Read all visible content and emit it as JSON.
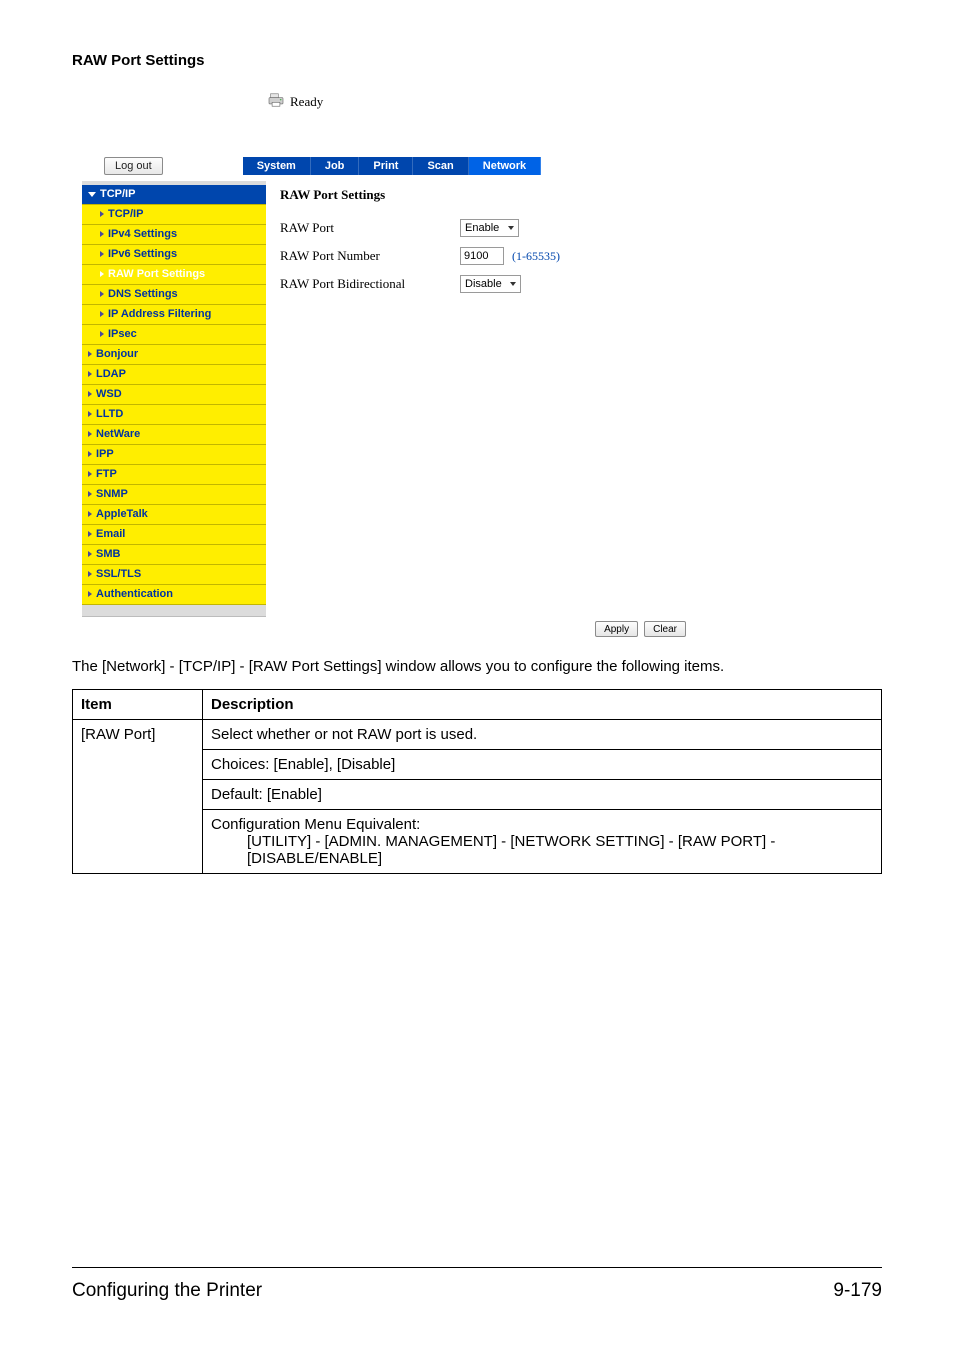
{
  "section_heading": "RAW Port Settings",
  "status_text": "Ready",
  "logout_label": "Log out",
  "tabs": {
    "system": "System",
    "job": "Job",
    "print": "Print",
    "scan": "Scan",
    "network": "Network"
  },
  "sidebar": {
    "tcpip_group": "TCP/IP",
    "tcpip": "TCP/IP",
    "ipv4": "IPv4 Settings",
    "ipv6": "IPv6 Settings",
    "raw": "RAW Port Settings",
    "dns": "DNS Settings",
    "ipfilter": "IP Address Filtering",
    "ipsec": "IPsec",
    "bonjour": "Bonjour",
    "ldap": "LDAP",
    "wsd": "WSD",
    "lltd": "LLTD",
    "netware": "NetWare",
    "ipp": "IPP",
    "ftp": "FTP",
    "snmp": "SNMP",
    "appletalk": "AppleTalk",
    "email": "Email",
    "smb": "SMB",
    "ssltls": "SSL/TLS",
    "auth": "Authentication"
  },
  "content": {
    "title": "RAW Port Settings",
    "raw_port_label": "RAW Port",
    "raw_port_value": "Enable",
    "raw_port_number_label": "RAW Port Number",
    "raw_port_number_value": "9100",
    "raw_port_number_range": "(1-65535)",
    "raw_port_bidir_label": "RAW Port Bidirectional",
    "raw_port_bidir_value": "Disable"
  },
  "buttons": {
    "apply": "Apply",
    "clear": "Clear"
  },
  "body_text": "The [Network] - [TCP/IP] - [RAW Port Settings] window allows you to configure the following items.",
  "table": {
    "h1": "Item",
    "h2": "Description",
    "item1": "[RAW Port]",
    "d1a": "Select whether or not RAW port is used.",
    "d1b": "Choices: [Enable], [Disable]",
    "d1c": "Default:  [Enable]",
    "d1d_line1": "Configuration Menu Equivalent:",
    "d1d_line2": "[UTILITY] - [ADMIN. MANAGEMENT] - [NETWORK SETTING] - [RAW PORT] - [DISABLE/ENABLE]"
  },
  "footer": {
    "left": "Configuring the Printer",
    "right": "9-179"
  }
}
